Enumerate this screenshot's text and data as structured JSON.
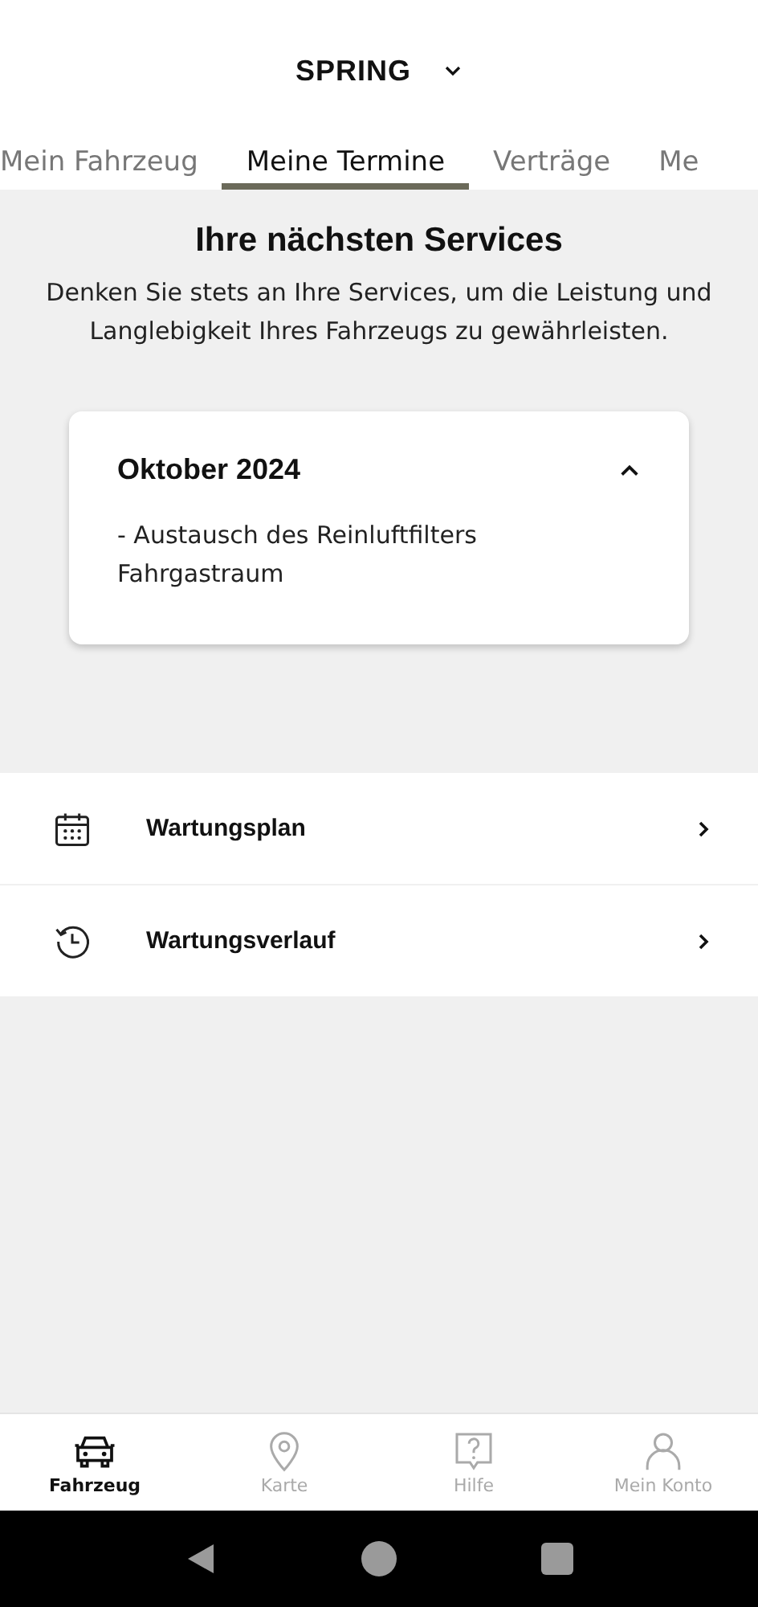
{
  "header": {
    "title": "SPRING"
  },
  "tabs": [
    {
      "label": "Mein Fahrzeug",
      "selected": false
    },
    {
      "label": "Meine Termine",
      "selected": true
    },
    {
      "label": "Verträge",
      "selected": false
    },
    {
      "label": "Me",
      "selected": false
    }
  ],
  "intro": {
    "title": "Ihre nächsten Services",
    "text": "Denken Sie stets an Ihre Services, um die Leistung und Langlebigkeit Ihres Fahrzeugs zu gewährleisten."
  },
  "service_card": {
    "title": "Oktober 2024",
    "expanded": true,
    "items": [
      "- Austausch des Reinluftfilters Fahrgastraum"
    ]
  },
  "menu": [
    {
      "kind": "calendar",
      "label": "Wartungsplan"
    },
    {
      "kind": "history",
      "label": "Wartungsverlauf"
    }
  ],
  "bottom_nav": [
    {
      "kind": "car",
      "label": "Fahrzeug",
      "selected": true
    },
    {
      "kind": "pin",
      "label": "Karte",
      "selected": false
    },
    {
      "kind": "help",
      "label": "Hilfe",
      "selected": false
    },
    {
      "kind": "person",
      "label": "Mein Konto",
      "selected": false
    }
  ]
}
